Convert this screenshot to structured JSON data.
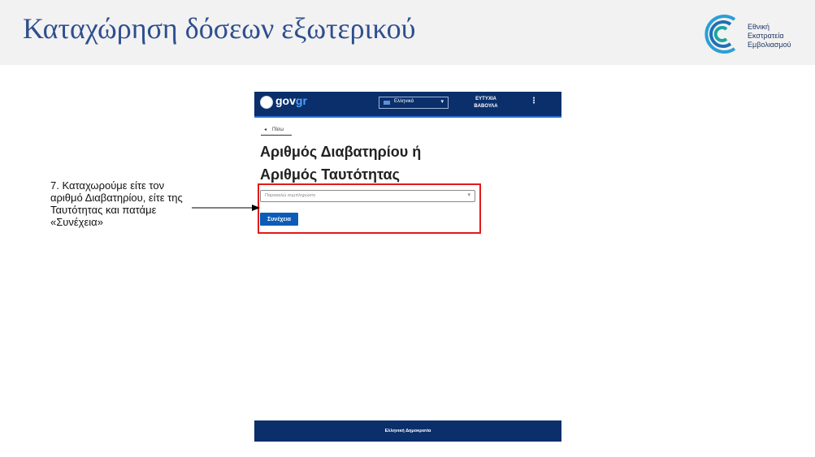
{
  "slide": {
    "title": "Καταχώρηση δόσεων εξωτερικού",
    "logo_lines": [
      "Εθνική",
      "Εκστρατεία",
      "Εμβολιασμού"
    ]
  },
  "govgr": {
    "brand_gov": "gov",
    "brand_gr": "gr",
    "language": "Ελληνικά",
    "user_name_lines": [
      "ΕΥΤΥΧΙΑ",
      "ΒΑΒΟΥΛΑ"
    ],
    "back_label": "Πίσω",
    "heading_lines": [
      "Αριθμός Διαβατηρίου ή",
      "Αριθμός Ταυτότητας"
    ],
    "input_placeholder": "Παρακαλώ συμπληρώστε",
    "continue_label": "Συνέχεια",
    "footer": "Ελληνική Δημοκρατία"
  },
  "annotation": {
    "text": "7. Καταχωρούμε είτε τον αριθμό Διαβατηρίου, είτε της Ταυτότητας και πατάμε «Συνέχεια»"
  },
  "colors": {
    "slide_title": "#2e4f8f",
    "gov_navy": "#0a2f6b",
    "primary_button": "#0b5cb8",
    "highlight": "#e21b1b"
  }
}
